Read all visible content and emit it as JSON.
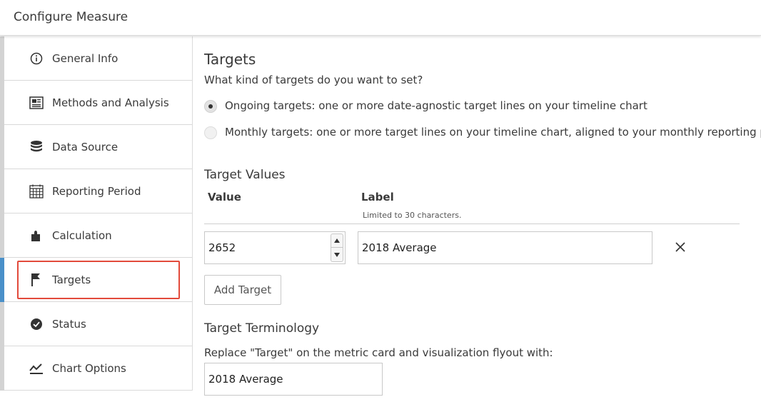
{
  "header": {
    "title": "Configure Measure"
  },
  "sidebar": {
    "items": [
      {
        "label": "General Info",
        "icon": "info-circle-icon"
      },
      {
        "label": "Methods and Analysis",
        "icon": "document-icon"
      },
      {
        "label": "Data Source",
        "icon": "database-icon"
      },
      {
        "label": "Reporting Period",
        "icon": "calendar-icon"
      },
      {
        "label": "Calculation",
        "icon": "puzzle-piece-icon"
      },
      {
        "label": "Targets",
        "icon": "flag-icon",
        "active": true
      },
      {
        "label": "Status",
        "icon": "check-circle-icon"
      },
      {
        "label": "Chart Options",
        "icon": "line-chart-icon"
      }
    ]
  },
  "targets": {
    "heading": "Targets",
    "question": "What kind of targets do you want to set?",
    "options": [
      {
        "label": "Ongoing targets: one or more date-agnostic target lines on your timeline chart",
        "selected": true
      },
      {
        "label": "Monthly targets: one or more target lines on your timeline chart, aligned to your monthly reporting period",
        "selected": false
      }
    ]
  },
  "target_values": {
    "heading": "Target Values",
    "value_header": "Value",
    "label_header": "Label",
    "label_hint": "Limited to 30 characters.",
    "rows": [
      {
        "value": "2652",
        "label": "2018 Average"
      }
    ],
    "add_button": "Add Target"
  },
  "terminology": {
    "heading": "Target Terminology",
    "description": "Replace \"Target\" on the metric card and visualization flyout with:",
    "value": "2018 Average"
  },
  "colors": {
    "active_accent": "#4a90c9",
    "highlight": "#e24a3b"
  }
}
